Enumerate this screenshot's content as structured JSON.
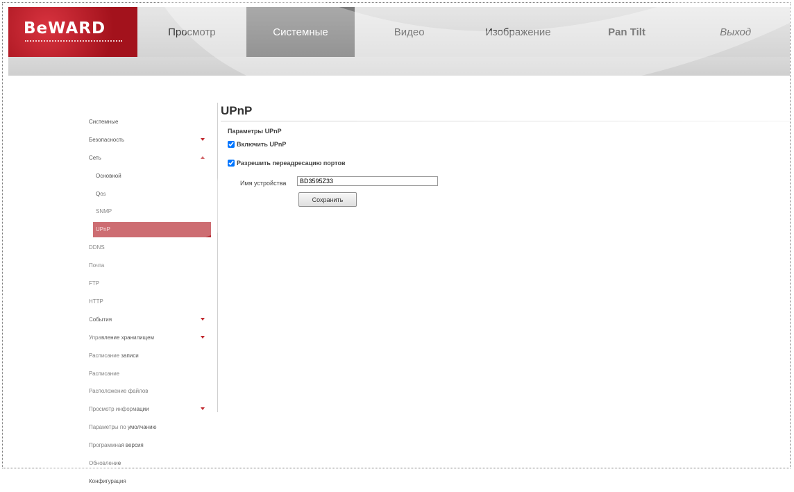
{
  "brand": {
    "name": "BeWARD"
  },
  "nav": {
    "tabs": [
      {
        "label": "Просмотр",
        "active": false
      },
      {
        "label": "Системные",
        "active": true
      },
      {
        "label": "Видео",
        "active": false
      },
      {
        "label": "Изображение",
        "active": false
      },
      {
        "label": "Pan Tilt",
        "active": false
      },
      {
        "label": "Выход",
        "active": false
      }
    ]
  },
  "sidebar": {
    "items": [
      {
        "label": "Системные"
      },
      {
        "label": "Безопасность"
      },
      {
        "label": "Сеть"
      },
      {
        "label": "Основной"
      },
      {
        "label": "Qos"
      },
      {
        "label": "SNMP"
      },
      {
        "label": "UPnP"
      },
      {
        "label": "DDNS"
      },
      {
        "label": "Почта"
      },
      {
        "label": "FTP"
      },
      {
        "label": "HTTP"
      },
      {
        "label": "События"
      },
      {
        "label": "Управление хранилищем"
      },
      {
        "label": "Расписание записи"
      },
      {
        "label": "Расписание"
      },
      {
        "label": "Расположение файлов"
      },
      {
        "label": "Просмотр информации"
      },
      {
        "label": "Параметры по умолчанию"
      },
      {
        "label": "Программная версия"
      },
      {
        "label": "Обновление"
      },
      {
        "label": "Конфигурация"
      }
    ]
  },
  "main": {
    "title": "UPnP",
    "section_title": "Параметры UPnP",
    "enable_upnp": {
      "label": "Включить UPnP",
      "checked": true
    },
    "port_forwarding": {
      "label": "Разрешить переадресацию портов",
      "checked": true
    },
    "device_name": {
      "label": "Имя устройства",
      "value": "BD3595Z33"
    },
    "save_label": "Сохранить"
  },
  "colors": {
    "accent": "#b82e35",
    "nav_active": "#666666",
    "logo_red": "#c1272d"
  }
}
